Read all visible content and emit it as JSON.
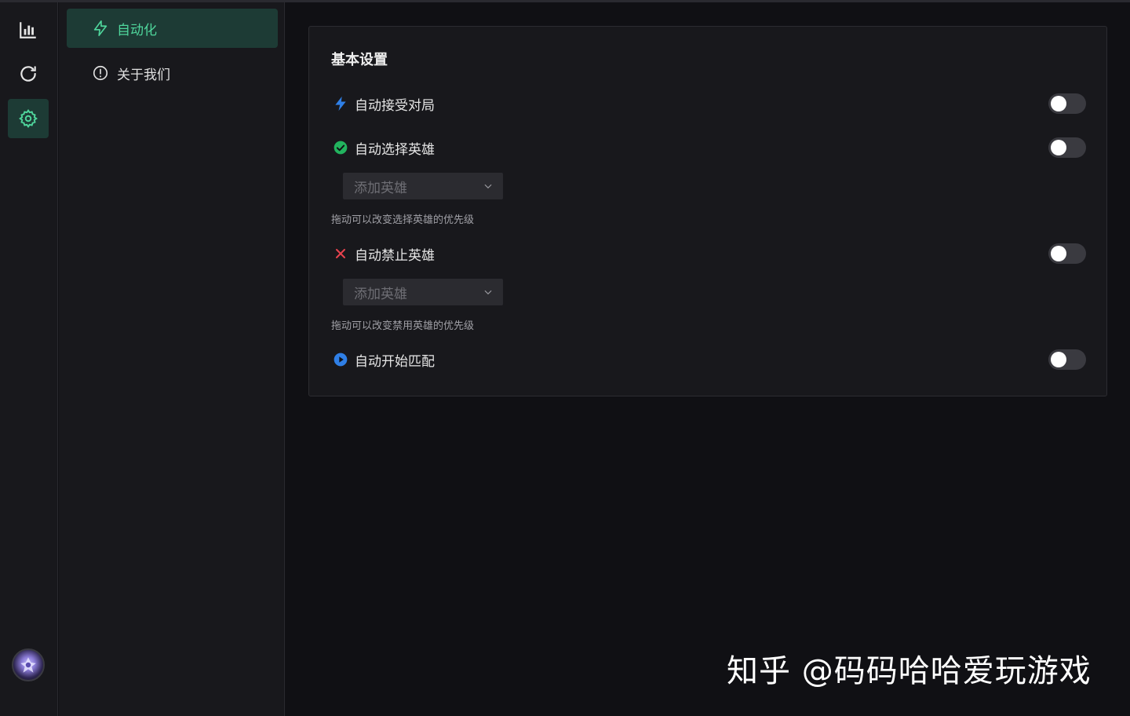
{
  "rail": {
    "items": [
      {
        "icon": "bar-chart-icon",
        "active": false
      },
      {
        "icon": "refresh-icon",
        "active": false
      },
      {
        "icon": "gear-icon",
        "active": true
      }
    ],
    "avatar_icon": "user-avatar-icon"
  },
  "menu": {
    "items": [
      {
        "label": "自动化",
        "icon": "lightning-icon",
        "active": true
      },
      {
        "label": "关于我们",
        "icon": "info-icon",
        "active": false
      }
    ]
  },
  "settings": {
    "title": "基本设置",
    "auto_accept": {
      "label": "自动接受对局",
      "icon": "lightning-icon",
      "enabled": false
    },
    "auto_pick": {
      "label": "自动选择英雄",
      "icon": "check-circle-icon",
      "enabled": false,
      "select_placeholder": "添加英雄",
      "hint": "拖动可以改变选择英雄的优先级"
    },
    "auto_ban": {
      "label": "自动禁止英雄",
      "icon": "x-icon",
      "enabled": false,
      "select_placeholder": "添加英雄",
      "hint": "拖动可以改变禁用英雄的优先级"
    },
    "auto_match": {
      "label": "自动开始匹配",
      "icon": "play-circle-icon",
      "enabled": false
    }
  },
  "watermark": "知乎 @码码哈哈爱玩游戏",
  "colors": {
    "accent": "#4fd69c",
    "active_bg": "#1d3b35",
    "blue": "#2f7fe6",
    "green": "#22b35e",
    "red": "#e8434e"
  }
}
